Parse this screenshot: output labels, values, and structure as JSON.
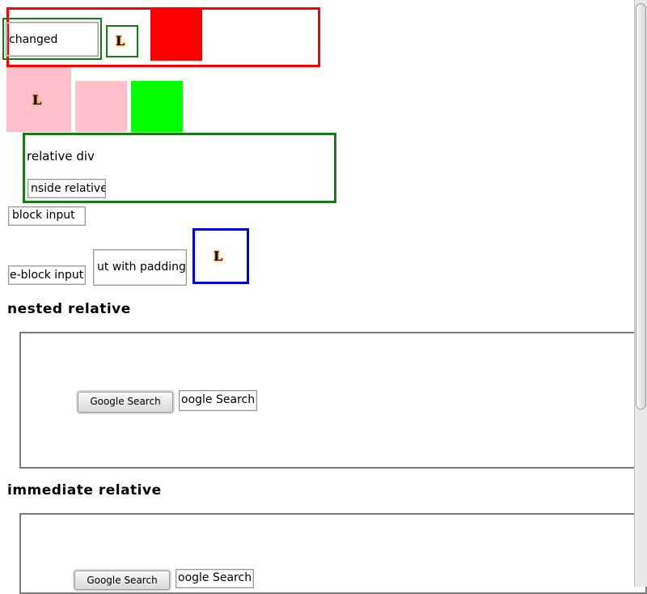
{
  "inputs": {
    "changed": "changed",
    "inside_relative": "nside relative",
    "block_input": "block input",
    "inline_block_input": "e-block input",
    "input_with_padding": "ut with padding"
  },
  "labels": {
    "relative_div": "relative div",
    "logo_glyph": "L"
  },
  "sections": {
    "nested_relative": {
      "heading": "nested relative",
      "button_label": "Google Search",
      "input_value": "oogle Search"
    },
    "immediate_relative": {
      "heading": "immediate relative",
      "button_label": "Google Search",
      "input_value": "oogle Search"
    }
  },
  "colors": {
    "red": "#ff0000",
    "green_border": "#1a7a1a",
    "pink": "#ffc0cb",
    "lime": "#00ff00",
    "blue_border": "#0000dd",
    "logo_glow": "#ff8a00"
  }
}
